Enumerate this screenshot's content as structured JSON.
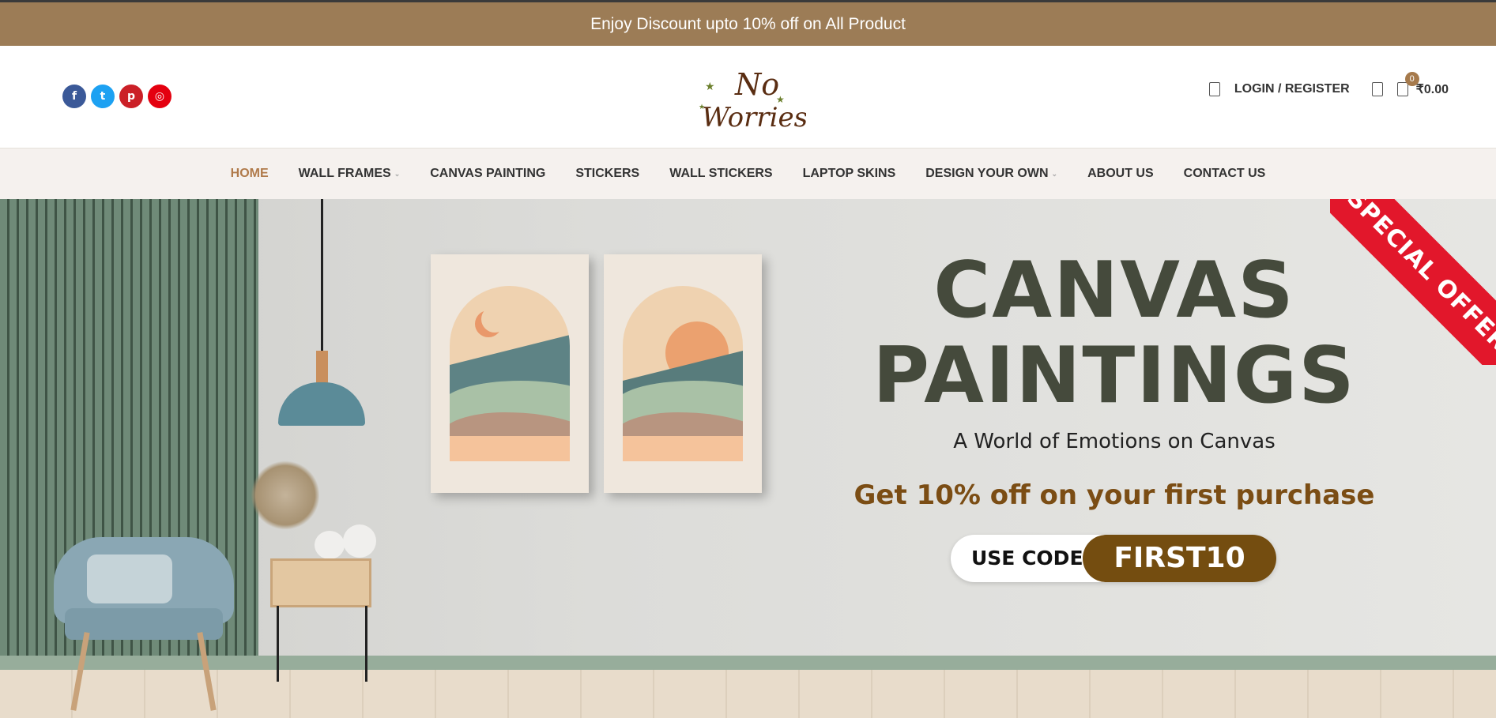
{
  "topbar": {
    "text": "Enjoy Discount upto 10% off on All Product"
  },
  "header": {
    "social": [
      {
        "name": "facebook-icon",
        "glyph": "f"
      },
      {
        "name": "twitter-icon",
        "glyph": "t"
      },
      {
        "name": "pinterest-icon",
        "glyph": "p"
      },
      {
        "name": "instagram-icon",
        "glyph": "◎"
      }
    ],
    "logo_line1": "No",
    "logo_line2": "Worries",
    "login_label": "LOGIN / REGISTER",
    "cart_count": "0",
    "cart_total": "₹0.00"
  },
  "nav": {
    "items": [
      {
        "label": "HOME",
        "active": true,
        "caret": false
      },
      {
        "label": "WALL FRAMES",
        "caret": true
      },
      {
        "label": "CANVAS PAINTING",
        "caret": false
      },
      {
        "label": "STICKERS",
        "caret": false
      },
      {
        "label": "WALL STICKERS",
        "caret": false
      },
      {
        "label": "LAPTOP SKINS",
        "caret": false
      },
      {
        "label": "DESIGN YOUR OWN",
        "caret": true
      },
      {
        "label": "ABOUT US",
        "caret": false
      },
      {
        "label": "CONTACT US",
        "caret": false
      }
    ]
  },
  "hero": {
    "headline_line1": "CANVAS",
    "headline_line2": "PAINTINGS",
    "subtitle": "A World of Emotions on Canvas",
    "offer": "Get 10% off on your first purchase",
    "code_label": "USE CODE",
    "code_value": "FIRST10",
    "ribbon": "SPECIAL OFFER"
  },
  "colors": {
    "accent": "#9c7c56",
    "brand_dark": "#744d10",
    "ribbon": "#e2172b"
  }
}
